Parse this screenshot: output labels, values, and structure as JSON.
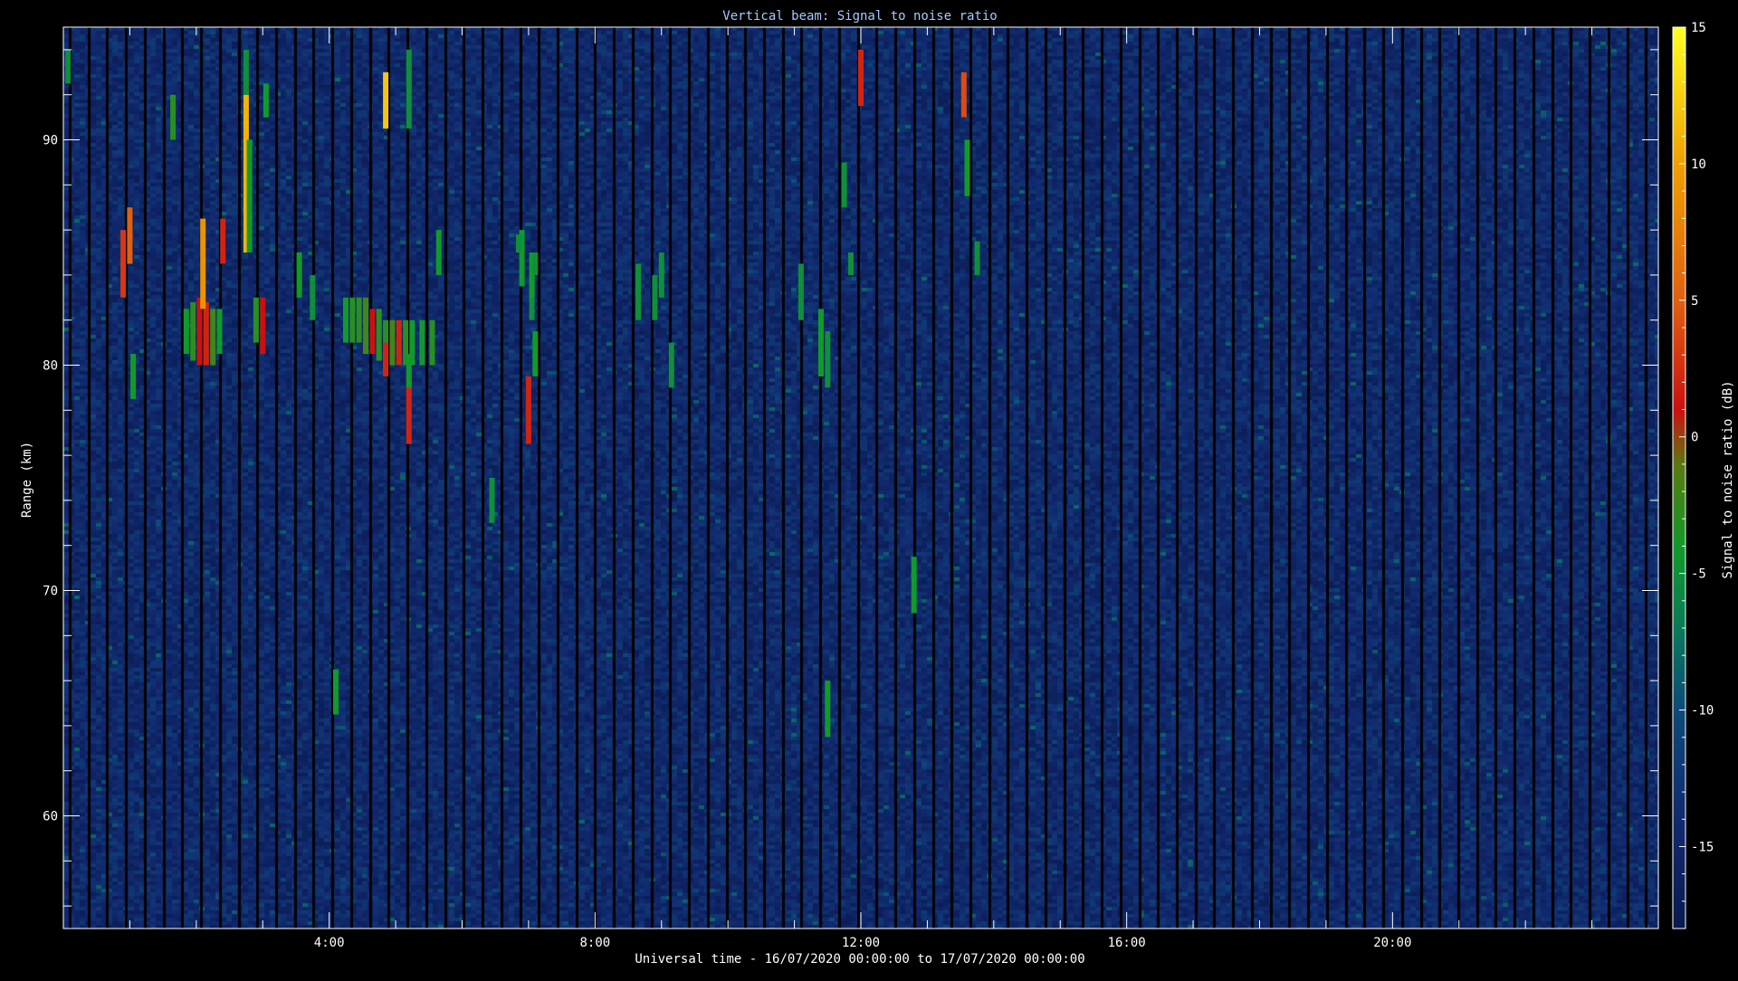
{
  "chart_data": {
    "type": "heatmap",
    "title": "Vertical beam: Signal to noise ratio",
    "xlabel": "Universal time - 16/07/2020 00:00:00 to 17/07/2020 00:00:00",
    "ylabel": "Range (km)",
    "colorbar_label": "Signal to noise ratio (dB)",
    "xlim_hours": [
      0,
      24
    ],
    "ylim_km": [
      55,
      95
    ],
    "zlim_db": [
      -18,
      15
    ],
    "x_major_ticks": [
      {
        "hours": 4,
        "label": "4:00"
      },
      {
        "hours": 8,
        "label": "8:00"
      },
      {
        "hours": 12,
        "label": "12:00"
      },
      {
        "hours": 16,
        "label": "16:00"
      },
      {
        "hours": 20,
        "label": "20:00"
      }
    ],
    "y_major_ticks": [
      {
        "km": 60,
        "label": "60"
      },
      {
        "km": 70,
        "label": "70"
      },
      {
        "km": 80,
        "label": "80"
      },
      {
        "km": 90,
        "label": "90"
      }
    ],
    "colorbar_ticks": [
      {
        "db": 15,
        "label": "15"
      },
      {
        "db": 10,
        "label": "10"
      },
      {
        "db": 5,
        "label": "5"
      },
      {
        "db": 0,
        "label": "0"
      },
      {
        "db": -5,
        "label": "-5"
      },
      {
        "db": -10,
        "label": "-10"
      },
      {
        "db": -15,
        "label": "-15"
      }
    ],
    "colormap": [
      {
        "db": -18,
        "color": "#0a1a50"
      },
      {
        "db": -14,
        "color": "#112a70"
      },
      {
        "db": -10,
        "color": "#0d4a7a"
      },
      {
        "db": -7,
        "color": "#0a7a5a"
      },
      {
        "db": -4,
        "color": "#119a2a"
      },
      {
        "db": -1,
        "color": "#5a7a10"
      },
      {
        "db": 1,
        "color": "#cc1010"
      },
      {
        "db": 5,
        "color": "#e06010"
      },
      {
        "db": 10,
        "color": "#f0a000"
      },
      {
        "db": 15,
        "color": "#ffff20"
      }
    ],
    "echoes": [
      {
        "t": 0.07,
        "r0": 92.5,
        "r1": 94.0,
        "db": -5
      },
      {
        "t": 0.9,
        "r0": 83.0,
        "r1": 86.0,
        "db": 3
      },
      {
        "t": 1.0,
        "r0": 84.5,
        "r1": 87.0,
        "db": 5
      },
      {
        "t": 1.05,
        "r0": 78.5,
        "r1": 80.5,
        "db": -4
      },
      {
        "t": 1.65,
        "r0": 90.0,
        "r1": 92.0,
        "db": -3
      },
      {
        "t": 1.85,
        "r0": 80.5,
        "r1": 82.5,
        "db": -4
      },
      {
        "t": 1.95,
        "r0": 80.2,
        "r1": 82.8,
        "db": -3
      },
      {
        "t": 2.05,
        "r0": 80.0,
        "r1": 83.0,
        "db": 1
      },
      {
        "t": 2.15,
        "r0": 80.0,
        "r1": 82.8,
        "db": 2
      },
      {
        "t": 2.25,
        "r0": 80.0,
        "r1": 82.5,
        "db": -2
      },
      {
        "t": 2.35,
        "r0": 80.5,
        "r1": 82.5,
        "db": -4
      },
      {
        "t": 2.1,
        "r0": 82.5,
        "r1": 86.5,
        "db": 9
      },
      {
        "t": 2.4,
        "r0": 84.5,
        "r1": 86.5,
        "db": 2
      },
      {
        "t": 2.75,
        "r0": 85.0,
        "r1": 92.0,
        "db": 11
      },
      {
        "t": 2.8,
        "r0": 85.0,
        "r1": 90.0,
        "db": -4
      },
      {
        "t": 2.75,
        "r0": 92.0,
        "r1": 94.0,
        "db": -5
      },
      {
        "t": 2.9,
        "r0": 81.0,
        "r1": 83.0,
        "db": -3
      },
      {
        "t": 3.0,
        "r0": 80.5,
        "r1": 83.0,
        "db": 1
      },
      {
        "t": 3.05,
        "r0": 91.0,
        "r1": 92.5,
        "db": -4
      },
      {
        "t": 3.75,
        "r0": 82.0,
        "r1": 84.0,
        "db": -5
      },
      {
        "t": 3.55,
        "r0": 83.0,
        "r1": 85.0,
        "db": -4
      },
      {
        "t": 4.25,
        "r0": 81.0,
        "r1": 83.0,
        "db": -4
      },
      {
        "t": 4.35,
        "r0": 81.0,
        "r1": 83.0,
        "db": -3
      },
      {
        "t": 4.45,
        "r0": 81.0,
        "r1": 83.0,
        "db": -3
      },
      {
        "t": 4.55,
        "r0": 80.5,
        "r1": 83.0,
        "db": -2
      },
      {
        "t": 4.65,
        "r0": 80.5,
        "r1": 82.5,
        "db": 1
      },
      {
        "t": 4.75,
        "r0": 80.2,
        "r1": 82.5,
        "db": -3
      },
      {
        "t": 4.85,
        "r0": 80.0,
        "r1": 82.0,
        "db": -3
      },
      {
        "t": 4.95,
        "r0": 80.0,
        "r1": 82.0,
        "db": -2
      },
      {
        "t": 5.05,
        "r0": 80.0,
        "r1": 82.0,
        "db": 2
      },
      {
        "t": 5.15,
        "r0": 80.0,
        "r1": 82.0,
        "db": -3
      },
      {
        "t": 5.25,
        "r0": 80.0,
        "r1": 82.0,
        "db": -4
      },
      {
        "t": 5.4,
        "r0": 80.0,
        "r1": 82.0,
        "db": -4
      },
      {
        "t": 5.55,
        "r0": 80.0,
        "r1": 82.0,
        "db": -3
      },
      {
        "t": 4.85,
        "r0": 90.5,
        "r1": 93.0,
        "db": 12
      },
      {
        "t": 4.85,
        "r0": 79.5,
        "r1": 81.0,
        "db": 2
      },
      {
        "t": 5.2,
        "r0": 76.5,
        "r1": 79.5,
        "db": 2
      },
      {
        "t": 5.2,
        "r0": 90.5,
        "r1": 94.0,
        "db": -5
      },
      {
        "t": 5.65,
        "r0": 84.0,
        "r1": 86.0,
        "db": -4
      },
      {
        "t": 4.1,
        "r0": 64.5,
        "r1": 66.5,
        "db": -4
      },
      {
        "t": 5.2,
        "r0": 79.0,
        "r1": 80.5,
        "db": -4
      },
      {
        "t": 6.45,
        "r0": 73.0,
        "r1": 75.0,
        "db": -5
      },
      {
        "t": 6.9,
        "r0": 83.5,
        "r1": 86.0,
        "db": -4
      },
      {
        "t": 7.05,
        "r0": 82.0,
        "r1": 84.0,
        "db": -5
      },
      {
        "t": 7.0,
        "r0": 76.5,
        "r1": 79.5,
        "db": 2
      },
      {
        "t": 7.1,
        "r0": 79.5,
        "r1": 81.5,
        "db": -4
      },
      {
        "t": 7.05,
        "r0": 83.0,
        "r1": 85.0,
        "db": -4
      },
      {
        "t": 7.1,
        "r0": 84.0,
        "r1": 85.0,
        "db": -5
      },
      {
        "t": 6.85,
        "r0": 85.0,
        "r1": 85.8,
        "db": -5
      },
      {
        "t": 8.65,
        "r0": 82.0,
        "r1": 84.5,
        "db": -5
      },
      {
        "t": 8.9,
        "r0": 82.0,
        "r1": 84.0,
        "db": -5
      },
      {
        "t": 9.0,
        "r0": 83.0,
        "r1": 85.0,
        "db": -5
      },
      {
        "t": 9.15,
        "r0": 79.0,
        "r1": 81.0,
        "db": -5
      },
      {
        "t": 11.1,
        "r0": 82.0,
        "r1": 84.5,
        "db": -5
      },
      {
        "t": 11.4,
        "r0": 79.5,
        "r1": 82.5,
        "db": -4
      },
      {
        "t": 11.5,
        "r0": 63.5,
        "r1": 66.0,
        "db": -4
      },
      {
        "t": 11.75,
        "r0": 87.0,
        "r1": 89.0,
        "db": -5
      },
      {
        "t": 12.0,
        "r0": 91.5,
        "r1": 94.0,
        "db": 2
      },
      {
        "t": 13.75,
        "r0": 84.0,
        "r1": 85.5,
        "db": -5
      },
      {
        "t": 13.55,
        "r0": 91.0,
        "r1": 93.0,
        "db": 4
      },
      {
        "t": 13.6,
        "r0": 87.5,
        "r1": 90.0,
        "db": -4
      },
      {
        "t": 11.5,
        "r0": 79.0,
        "r1": 81.5,
        "db": -5
      },
      {
        "t": 12.8,
        "r0": 69.0,
        "r1": 71.5,
        "db": -4
      },
      {
        "t": 11.85,
        "r0": 84.0,
        "r1": 85.0,
        "db": -5
      }
    ]
  }
}
